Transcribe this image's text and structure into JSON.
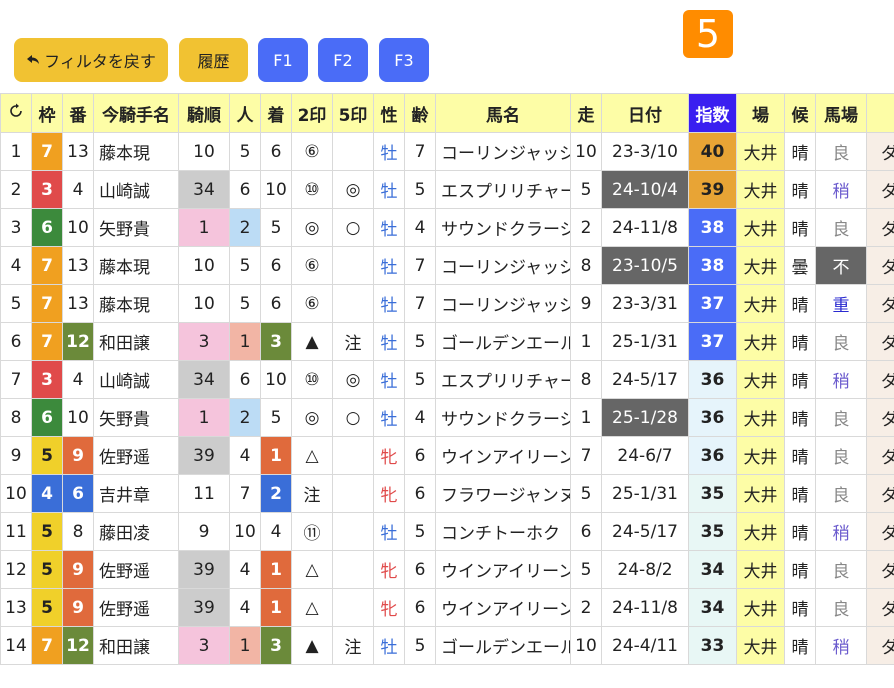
{
  "toolbar": {
    "back_label": "フィルタを戻す",
    "history_label": "履歴",
    "f1_label": "F1",
    "f2_label": "F2",
    "f3_label": "F3",
    "race_number": "5"
  },
  "colors": {
    "rank_high": "#e8a435",
    "rank_mid": "#4a6cf7",
    "date_dark": "#666666",
    "gray_cell": "#cccccc",
    "pink_cell": "#f5c4dc",
    "blue_cell": "#bcdcf5",
    "salmon_cell": "#f2b5a5",
    "green_cell": "#6b8a3a",
    "orange_cell": "#e06a3c",
    "male_color": "#3a6ed8",
    "female_color": "#e04a4a",
    "venue_bg": "#fdfda6",
    "index_head": "#3a1ff0"
  },
  "columns": [
    "",
    "枠",
    "番",
    "今騎手名",
    "騎順",
    "人",
    "着",
    "2印",
    "5印",
    "性",
    "齢",
    "馬名",
    "走",
    "日付",
    "指数",
    "場",
    "候",
    "馬場",
    ""
  ],
  "rows": [
    {
      "no": "1",
      "waku": "7",
      "ban": "13",
      "jockey": "藤本現",
      "kijun": "10",
      "ninki": "5",
      "chaku": "6",
      "m2": "⑥",
      "m5": "",
      "sex": "牡",
      "age": "7",
      "horse": "コーリンジャッジ",
      "run": "10",
      "date": "23-3/10",
      "idx": "40",
      "venue": "大井",
      "weather": "晴",
      "track": "良",
      "surface": "ダ"
    },
    {
      "no": "2",
      "waku": "3",
      "ban": "4",
      "jockey": "山崎誠",
      "kijun": "34",
      "ninki": "6",
      "chaku": "10",
      "m2": "⑩",
      "m5": "◎",
      "sex": "牡",
      "age": "5",
      "horse": "エスプリリチャード",
      "run": "5",
      "date": "24-10/4",
      "idx": "39",
      "venue": "大井",
      "weather": "晴",
      "track": "稍",
      "surface": "ダ"
    },
    {
      "no": "3",
      "waku": "6",
      "ban": "10",
      "jockey": "矢野貴",
      "kijun": "1",
      "ninki": "2",
      "chaku": "5",
      "m2": "◎",
      "m5": "○",
      "sex": "牡",
      "age": "4",
      "horse": "サウンドクラージュ",
      "run": "2",
      "date": "24-11/8",
      "idx": "38",
      "venue": "大井",
      "weather": "晴",
      "track": "良",
      "surface": "ダ"
    },
    {
      "no": "4",
      "waku": "7",
      "ban": "13",
      "jockey": "藤本現",
      "kijun": "10",
      "ninki": "5",
      "chaku": "6",
      "m2": "⑥",
      "m5": "",
      "sex": "牡",
      "age": "7",
      "horse": "コーリンジャッジ",
      "run": "8",
      "date": "23-10/5",
      "idx": "38",
      "venue": "大井",
      "weather": "曇",
      "track": "不",
      "surface": "ダ"
    },
    {
      "no": "5",
      "waku": "7",
      "ban": "13",
      "jockey": "藤本現",
      "kijun": "10",
      "ninki": "5",
      "chaku": "6",
      "m2": "⑥",
      "m5": "",
      "sex": "牡",
      "age": "7",
      "horse": "コーリンジャッジ",
      "run": "9",
      "date": "23-3/31",
      "idx": "37",
      "venue": "大井",
      "weather": "晴",
      "track": "重",
      "surface": "ダ"
    },
    {
      "no": "6",
      "waku": "7",
      "ban": "12",
      "jockey": "和田譲",
      "kijun": "3",
      "ninki": "1",
      "chaku": "3",
      "m2": "▲",
      "m5": "注",
      "sex": "牡",
      "age": "5",
      "horse": "ゴールデンエール",
      "run": "1",
      "date": "25-1/31",
      "idx": "37",
      "venue": "大井",
      "weather": "晴",
      "track": "良",
      "surface": "ダ"
    },
    {
      "no": "7",
      "waku": "3",
      "ban": "4",
      "jockey": "山崎誠",
      "kijun": "34",
      "ninki": "6",
      "chaku": "10",
      "m2": "⑩",
      "m5": "◎",
      "sex": "牡",
      "age": "5",
      "horse": "エスプリリチャード",
      "run": "8",
      "date": "24-5/17",
      "idx": "36",
      "venue": "大井",
      "weather": "晴",
      "track": "稍",
      "surface": "ダ"
    },
    {
      "no": "8",
      "waku": "6",
      "ban": "10",
      "jockey": "矢野貴",
      "kijun": "1",
      "ninki": "2",
      "chaku": "5",
      "m2": "◎",
      "m5": "○",
      "sex": "牡",
      "age": "4",
      "horse": "サウンドクラージュ",
      "run": "1",
      "date": "25-1/28",
      "idx": "36",
      "venue": "大井",
      "weather": "晴",
      "track": "良",
      "surface": "ダ"
    },
    {
      "no": "9",
      "waku": "5",
      "ban": "9",
      "jockey": "佐野遥",
      "kijun": "39",
      "ninki": "4",
      "chaku": "1",
      "m2": "△",
      "m5": "",
      "sex": "牝",
      "age": "6",
      "horse": "ウインアイリーン",
      "run": "7",
      "date": "24-6/7",
      "idx": "36",
      "venue": "大井",
      "weather": "晴",
      "track": "良",
      "surface": "ダ"
    },
    {
      "no": "10",
      "waku": "4",
      "ban": "6",
      "jockey": "吉井章",
      "kijun": "11",
      "ninki": "7",
      "chaku": "2",
      "m2": "注",
      "m5": "",
      "sex": "牝",
      "age": "6",
      "horse": "フラワージャンヌ",
      "run": "5",
      "date": "25-1/31",
      "idx": "35",
      "venue": "大井",
      "weather": "晴",
      "track": "良",
      "surface": "ダ"
    },
    {
      "no": "11",
      "waku": "5",
      "ban": "8",
      "jockey": "藤田凌",
      "kijun": "9",
      "ninki": "10",
      "chaku": "4",
      "m2": "⑪",
      "m5": "",
      "sex": "牡",
      "age": "5",
      "horse": "コンチトーホク",
      "run": "6",
      "date": "24-5/17",
      "idx": "35",
      "venue": "大井",
      "weather": "晴",
      "track": "稍",
      "surface": "ダ"
    },
    {
      "no": "12",
      "waku": "5",
      "ban": "9",
      "jockey": "佐野遥",
      "kijun": "39",
      "ninki": "4",
      "chaku": "1",
      "m2": "△",
      "m5": "",
      "sex": "牝",
      "age": "6",
      "horse": "ウインアイリーン",
      "run": "5",
      "date": "24-8/2",
      "idx": "34",
      "venue": "大井",
      "weather": "晴",
      "track": "良",
      "surface": "ダ"
    },
    {
      "no": "13",
      "waku": "5",
      "ban": "9",
      "jockey": "佐野遥",
      "kijun": "39",
      "ninki": "4",
      "chaku": "1",
      "m2": "△",
      "m5": "",
      "sex": "牝",
      "age": "6",
      "horse": "ウインアイリーン",
      "run": "2",
      "date": "24-11/8",
      "idx": "34",
      "venue": "大井",
      "weather": "晴",
      "track": "良",
      "surface": "ダ"
    },
    {
      "no": "14",
      "waku": "7",
      "ban": "12",
      "jockey": "和田譲",
      "kijun": "3",
      "ninki": "1",
      "chaku": "3",
      "m2": "▲",
      "m5": "注",
      "sex": "牡",
      "age": "5",
      "horse": "ゴールデンエール",
      "run": "10",
      "date": "24-4/11",
      "idx": "33",
      "venue": "大井",
      "weather": "晴",
      "track": "稍",
      "surface": "ダ"
    }
  ]
}
